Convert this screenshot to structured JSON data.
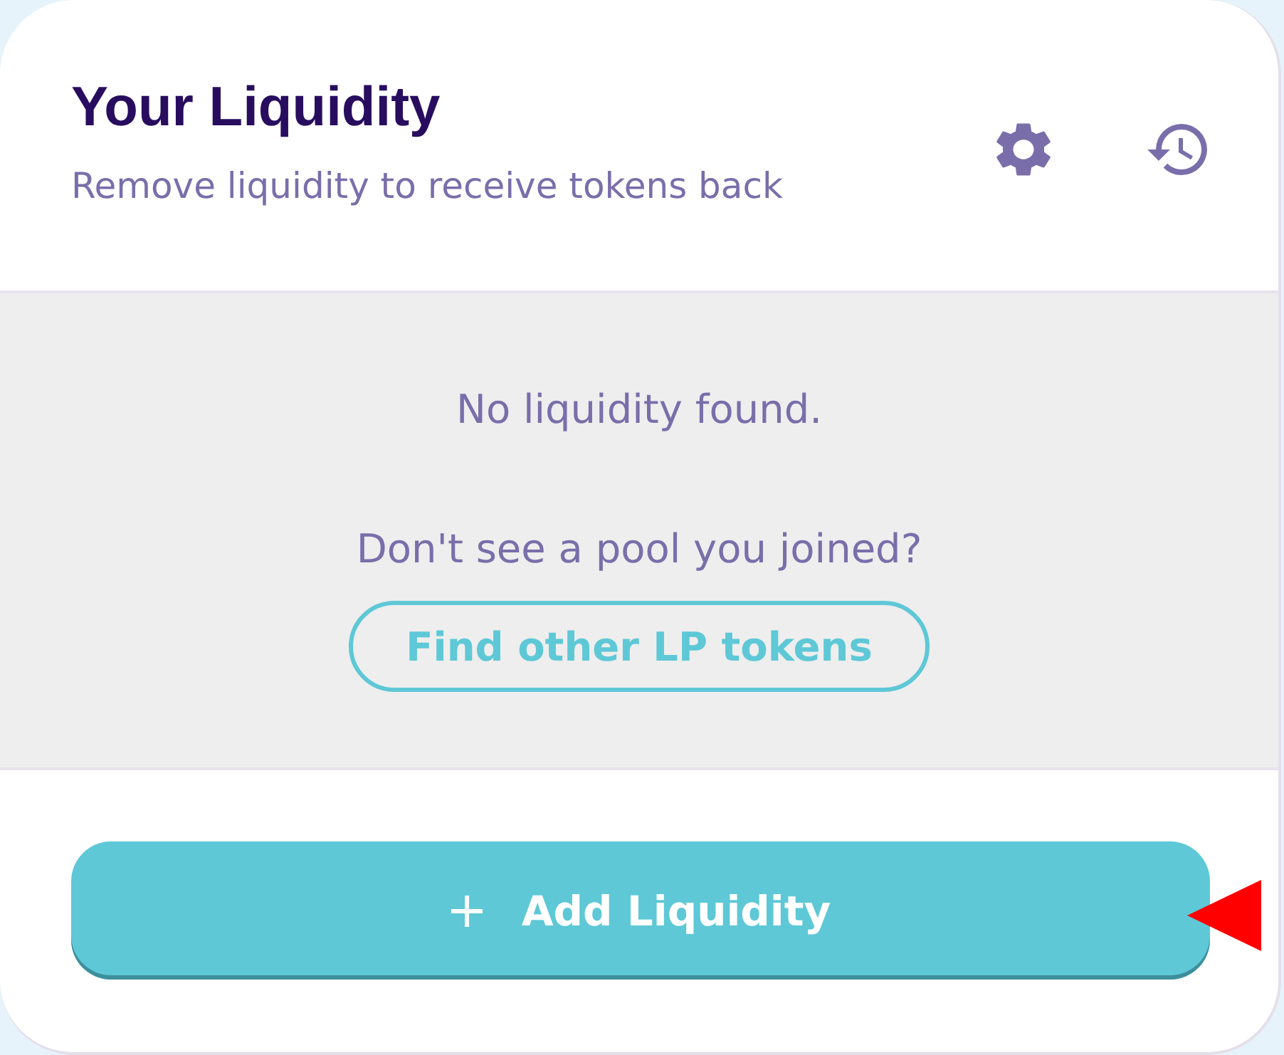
{
  "header": {
    "title": "Your Liquidity",
    "subtitle": "Remove liquidity to receive tokens back"
  },
  "empty_state": {
    "message": "No liquidity found.",
    "prompt": "Don't see a pool you joined?",
    "find_button": "Find other LP tokens"
  },
  "footer": {
    "add_button": "Add Liquidity"
  }
}
